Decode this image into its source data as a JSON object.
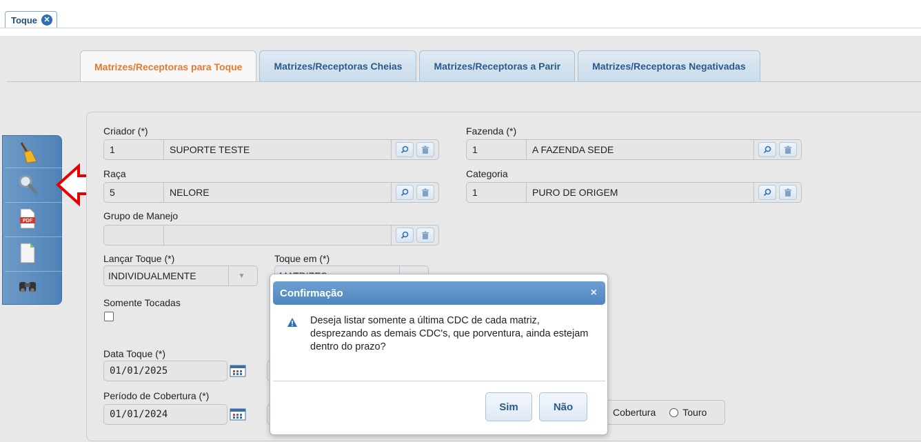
{
  "top_tab": {
    "label": "Toque"
  },
  "tabs": [
    {
      "label": "Matrizes/Receptoras para Toque",
      "active": true
    },
    {
      "label": "Matrizes/Receptoras Cheias",
      "active": false
    },
    {
      "label": "Matrizes/Receptoras a Parir",
      "active": false
    },
    {
      "label": "Matrizes/Receptoras Negativadas",
      "active": false
    }
  ],
  "toolbar": {
    "icons": [
      "broom-icon",
      "magnifier-icon",
      "pdf-icon",
      "document-icon",
      "binoculars-icon"
    ],
    "pdf_text": "PDF"
  },
  "form": {
    "criador": {
      "label": "Criador (*)",
      "code": "1",
      "desc": "SUPORTE TESTE"
    },
    "fazenda": {
      "label": "Fazenda (*)",
      "code": "1",
      "desc": "A FAZENDA SEDE"
    },
    "raca": {
      "label": "Raça",
      "code": "5",
      "desc": "NELORE"
    },
    "categoria": {
      "label": "Categoria",
      "code": "1",
      "desc": "PURO DE ORIGEM"
    },
    "grupo_manejo": {
      "label": "Grupo de Manejo",
      "code": "",
      "desc": ""
    },
    "lancar_toque": {
      "label": "Lançar Toque (*)",
      "value": "INDIVIDUALMENTE"
    },
    "toque_em": {
      "label": "Toque em (*)",
      "value": "MATRIZES"
    },
    "somente_tocadas": {
      "label": "Somente Tocadas"
    },
    "data_toque": {
      "label": "Data Toque (*)",
      "value": "01/01/2025"
    },
    "periodo_cobertura": {
      "label": "Período de Cobertura (*)",
      "value": "01/01/2024"
    },
    "radio_options": [
      "Cobertura",
      "Touro"
    ]
  },
  "modal": {
    "title": "Confirmação",
    "close": "×",
    "message": "Deseja listar somente a última CDC de cada matriz, desprezando as demais CDC's, que porventura, ainda estejam dentro do prazo?",
    "yes_label": "Sim",
    "no_label": "Não"
  }
}
